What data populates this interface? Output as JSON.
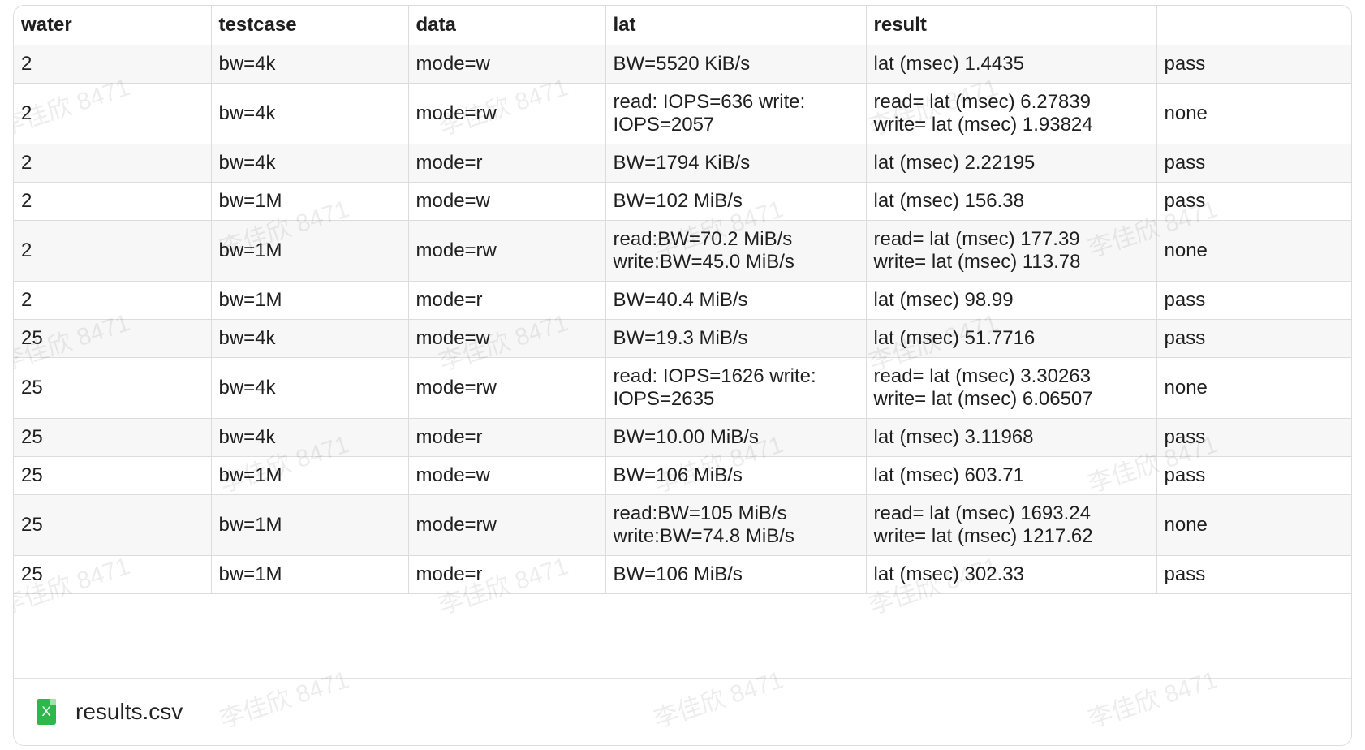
{
  "table": {
    "headers": [
      "water",
      "testcase",
      "data",
      "lat",
      "result",
      ""
    ],
    "rows": [
      {
        "water": "2",
        "testcase": "bw=4k",
        "data": "mode=w",
        "lat": [
          "BW=5520 KiB/s"
        ],
        "result": [
          "lat (msec) 1.4435"
        ],
        "status": "pass"
      },
      {
        "water": "2",
        "testcase": "bw=4k",
        "data": "mode=rw",
        "lat": [
          "read: IOPS=636 write:",
          "IOPS=2057"
        ],
        "result": [
          "read= lat (msec) 6.27839",
          "write= lat (msec) 1.93824"
        ],
        "status": "none"
      },
      {
        "water": "2",
        "testcase": "bw=4k",
        "data": "mode=r",
        "lat": [
          "BW=1794 KiB/s"
        ],
        "result": [
          "lat (msec) 2.22195"
        ],
        "status": "pass"
      },
      {
        "water": "2",
        "testcase": "bw=1M",
        "data": "mode=w",
        "lat": [
          "BW=102 MiB/s"
        ],
        "result": [
          "lat (msec) 156.38"
        ],
        "status": "pass"
      },
      {
        "water": "2",
        "testcase": "bw=1M",
        "data": "mode=rw",
        "lat": [
          "read:BW=70.2 MiB/s",
          "write:BW=45.0 MiB/s"
        ],
        "result": [
          "read= lat (msec) 177.39",
          "write= lat (msec) 113.78"
        ],
        "status": "none"
      },
      {
        "water": "2",
        "testcase": "bw=1M",
        "data": "mode=r",
        "lat": [
          "BW=40.4 MiB/s"
        ],
        "result": [
          "lat (msec) 98.99"
        ],
        "status": "pass"
      },
      {
        "water": "25",
        "testcase": "bw=4k",
        "data": "mode=w",
        "lat": [
          "BW=19.3 MiB/s"
        ],
        "result": [
          "lat (msec) 51.7716"
        ],
        "status": "pass"
      },
      {
        "water": "25",
        "testcase": "bw=4k",
        "data": "mode=rw",
        "lat": [
          "read: IOPS=1626 write:",
          "IOPS=2635"
        ],
        "result": [
          "read= lat (msec) 3.30263",
          "write= lat (msec) 6.06507"
        ],
        "status": "none"
      },
      {
        "water": "25",
        "testcase": "bw=4k",
        "data": "mode=r",
        "lat": [
          "BW=10.00 MiB/s"
        ],
        "result": [
          "lat (msec) 3.11968"
        ],
        "status": "pass"
      },
      {
        "water": "25",
        "testcase": "bw=1M",
        "data": "mode=w",
        "lat": [
          "BW=106 MiB/s"
        ],
        "result": [
          "lat (msec) 603.71"
        ],
        "status": "pass"
      },
      {
        "water": "25",
        "testcase": "bw=1M",
        "data": "mode=rw",
        "lat": [
          "read:BW=105 MiB/s",
          "write:BW=74.8 MiB/s"
        ],
        "result": [
          "read= lat (msec) 1693.24",
          "write= lat (msec) 1217.62"
        ],
        "status": "none"
      },
      {
        "water": "25",
        "testcase": "bw=1M",
        "data": "mode=r",
        "lat": [
          "BW=106 MiB/s"
        ],
        "result": [
          "lat (msec) 302.33"
        ],
        "status": "pass"
      }
    ]
  },
  "attachment": {
    "icon": "excel-file-icon",
    "icon_glyph": "X",
    "file_name": "results.csv"
  },
  "watermark": {
    "text": "李佳欣 8471"
  },
  "colors": {
    "border": "#dcdcdc",
    "row_alt": "#f7f7f7",
    "icon_green": "#2db84c"
  }
}
